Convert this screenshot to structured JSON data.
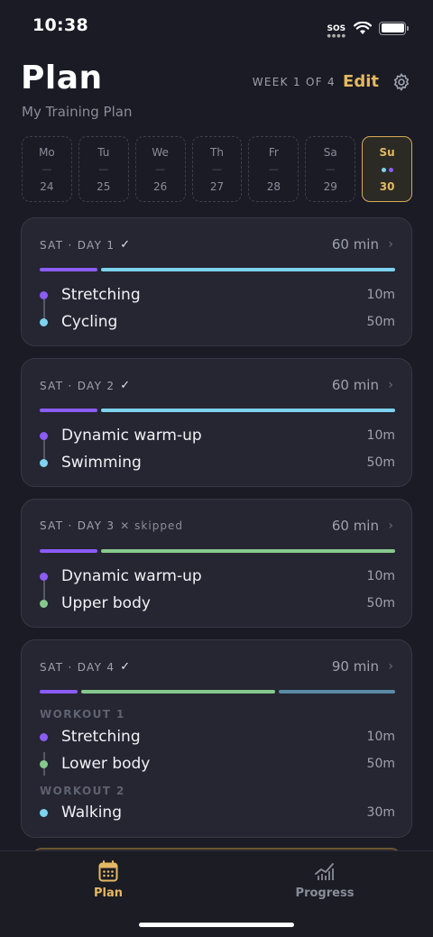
{
  "status": {
    "time": "10:38",
    "sos": "SOS"
  },
  "header": {
    "title": "Plan",
    "subtitle": "My Training Plan",
    "week_label": "WEEK 1 OF 4",
    "edit_label": "Edit"
  },
  "colors": {
    "accent": "#e4b963",
    "purple": "#8b5cf6",
    "blue": "#7dd3f0",
    "green": "#86c98d",
    "steel": "#5b8aa6"
  },
  "days": [
    {
      "name": "Mo",
      "mark": "—",
      "num": "24"
    },
    {
      "name": "Tu",
      "mark": "—",
      "num": "25"
    },
    {
      "name": "We",
      "mark": "—",
      "num": "26"
    },
    {
      "name": "Th",
      "mark": "—",
      "num": "27"
    },
    {
      "name": "Fr",
      "mark": "—",
      "num": "28"
    },
    {
      "name": "Sa",
      "mark": "—",
      "num": "29"
    },
    {
      "name": "Su",
      "num": "30",
      "active": true
    }
  ],
  "cards": [
    {
      "header": "SAT · DAY 1",
      "status_mark": "✓",
      "duration": "60 min",
      "exercises": [
        {
          "name": "Stretching",
          "duration": "10m"
        },
        {
          "name": "Cycling",
          "duration": "50m"
        }
      ]
    },
    {
      "header": "SAT · DAY 2",
      "status_mark": "✓",
      "duration": "60 min",
      "exercises": [
        {
          "name": "Dynamic warm-up",
          "duration": "10m"
        },
        {
          "name": "Swimming",
          "duration": "50m"
        }
      ]
    },
    {
      "header": "SAT · DAY 3",
      "status_mark": "✕",
      "status_text": "skipped",
      "duration": "60 min",
      "exercises": [
        {
          "name": "Dynamic warm-up",
          "duration": "10m"
        },
        {
          "name": "Upper body",
          "duration": "50m"
        }
      ]
    },
    {
      "header": "SAT · DAY 4",
      "status_mark": "✓",
      "duration": "90 min",
      "workouts": [
        {
          "label": "WORKOUT 1",
          "exercises": [
            {
              "name": "Stretching",
              "duration": "10m"
            },
            {
              "name": "Lower body",
              "duration": "50m"
            }
          ]
        },
        {
          "label": "WORKOUT 2",
          "exercises": [
            {
              "name": "Walking",
              "duration": "30m"
            }
          ]
        }
      ]
    }
  ],
  "tabbar": {
    "plan_label": "Plan",
    "progress_label": "Progress"
  }
}
